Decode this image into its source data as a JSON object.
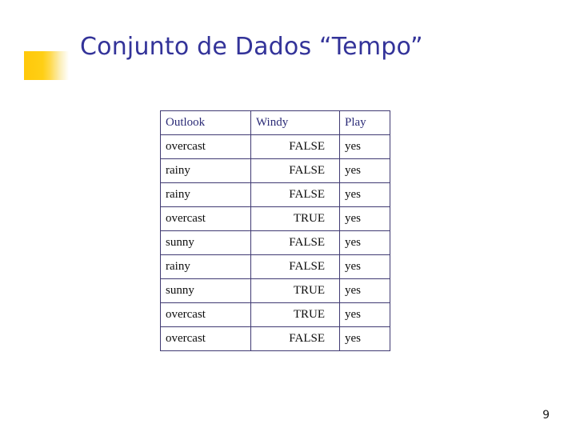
{
  "slide": {
    "title": "Conjunto de Dados “Tempo”",
    "page_number": "9",
    "accent_color": "#ffc80a",
    "title_color": "#333399",
    "table_border_color": "#403a72",
    "header_text_color": "#2b2b77",
    "body_text_color": "#0d0d0d",
    "background_color": "#ffffff"
  },
  "table": {
    "columns": [
      {
        "key": "outlook",
        "label": "Outlook",
        "align": "left"
      },
      {
        "key": "windy",
        "label": "Windy",
        "align": "right"
      },
      {
        "key": "play",
        "label": "Play",
        "align": "left"
      }
    ],
    "rows": [
      {
        "outlook": "overcast",
        "windy": "FALSE",
        "play": "yes"
      },
      {
        "outlook": "rainy",
        "windy": "FALSE",
        "play": "yes"
      },
      {
        "outlook": "rainy",
        "windy": "FALSE",
        "play": "yes"
      },
      {
        "outlook": "overcast",
        "windy": "TRUE",
        "play": "yes"
      },
      {
        "outlook": "sunny",
        "windy": "FALSE",
        "play": "yes"
      },
      {
        "outlook": "rainy",
        "windy": "FALSE",
        "play": "yes"
      },
      {
        "outlook": "sunny",
        "windy": "TRUE",
        "play": "yes"
      },
      {
        "outlook": "overcast",
        "windy": "TRUE",
        "play": "yes"
      },
      {
        "outlook": "overcast",
        "windy": "FALSE",
        "play": "yes"
      }
    ]
  }
}
